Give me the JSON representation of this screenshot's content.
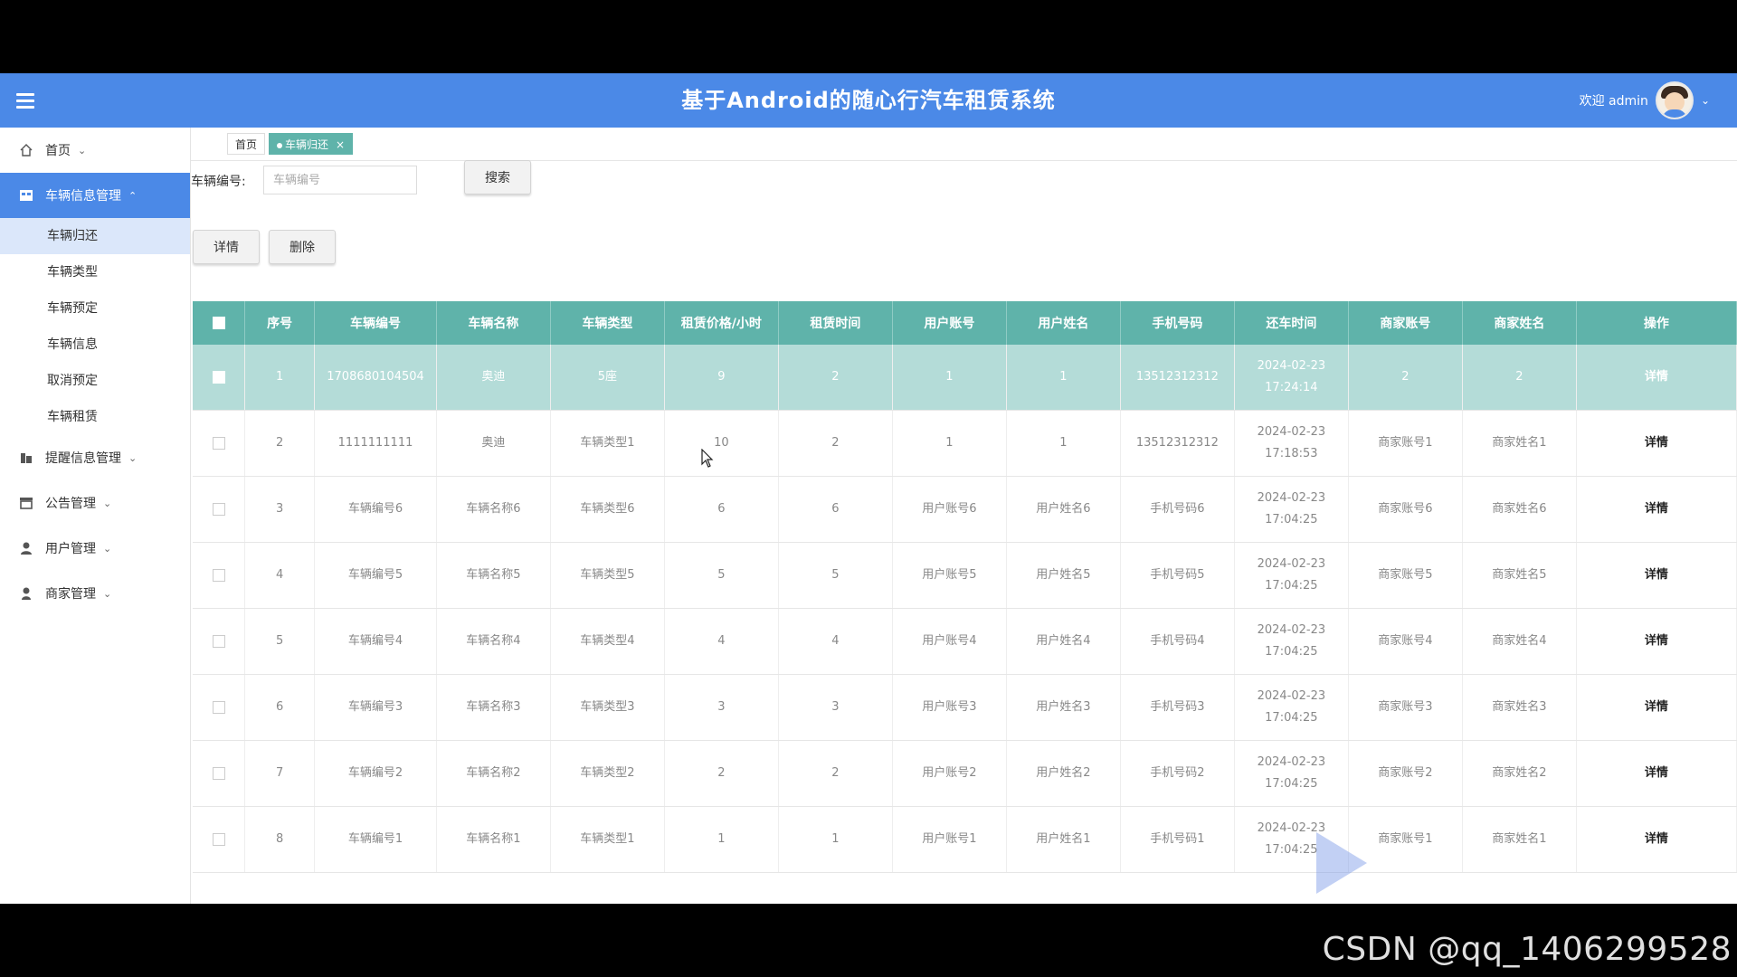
{
  "header": {
    "title": "基于Android的随心行汽车租赁系统",
    "welcome": "欢迎 admin"
  },
  "sidebar": {
    "items": [
      {
        "label": "首页",
        "icon": "home-icon"
      },
      {
        "label": "车辆信息管理",
        "icon": "car-info-icon",
        "active": true
      },
      {
        "label": "提醒信息管理",
        "icon": "reminder-icon"
      },
      {
        "label": "公告管理",
        "icon": "notice-icon"
      },
      {
        "label": "用户管理",
        "icon": "user-icon"
      },
      {
        "label": "商家管理",
        "icon": "merchant-icon"
      }
    ],
    "subitems": [
      "车辆归还",
      "车辆类型",
      "车辆预定",
      "车辆信息",
      "取消预定",
      "车辆租赁"
    ]
  },
  "tabs": {
    "home": "首页",
    "current": "车辆归还",
    "close": "×"
  },
  "search": {
    "label": "车辆编号:",
    "placeholder": "车辆编号",
    "button": "搜索"
  },
  "actions": {
    "detail": "详情",
    "delete": "删除"
  },
  "table": {
    "headers": [
      "序号",
      "车辆编号",
      "车辆名称",
      "车辆类型",
      "租赁价格/小时",
      "租赁时间",
      "用户账号",
      "用户姓名",
      "手机号码",
      "还车时间",
      "商家账号",
      "商家姓名",
      "操作"
    ],
    "rows": [
      [
        "1",
        "1708680104504",
        "奥迪",
        "5座",
        "9",
        "2",
        "1",
        "1",
        "13512312312",
        "2024-02-23 17:24:14",
        "2",
        "2",
        "详情"
      ],
      [
        "2",
        "1111111111",
        "奥迪",
        "车辆类型1",
        "10",
        "2",
        "1",
        "1",
        "13512312312",
        "2024-02-23 17:18:53",
        "商家账号1",
        "商家姓名1",
        "详情"
      ],
      [
        "3",
        "车辆编号6",
        "车辆名称6",
        "车辆类型6",
        "6",
        "6",
        "用户账号6",
        "用户姓名6",
        "手机号码6",
        "2024-02-23 17:04:25",
        "商家账号6",
        "商家姓名6",
        "详情"
      ],
      [
        "4",
        "车辆编号5",
        "车辆名称5",
        "车辆类型5",
        "5",
        "5",
        "用户账号5",
        "用户姓名5",
        "手机号码5",
        "2024-02-23 17:04:25",
        "商家账号5",
        "商家姓名5",
        "详情"
      ],
      [
        "5",
        "车辆编号4",
        "车辆名称4",
        "车辆类型4",
        "4",
        "4",
        "用户账号4",
        "用户姓名4",
        "手机号码4",
        "2024-02-23 17:04:25",
        "商家账号4",
        "商家姓名4",
        "详情"
      ],
      [
        "6",
        "车辆编号3",
        "车辆名称3",
        "车辆类型3",
        "3",
        "3",
        "用户账号3",
        "用户姓名3",
        "手机号码3",
        "2024-02-23 17:04:25",
        "商家账号3",
        "商家姓名3",
        "详情"
      ],
      [
        "7",
        "车辆编号2",
        "车辆名称2",
        "车辆类型2",
        "2",
        "2",
        "用户账号2",
        "用户姓名2",
        "手机号码2",
        "2024-02-23 17:04:25",
        "商家账号2",
        "商家姓名2",
        "详情"
      ],
      [
        "8",
        "车辆编号1",
        "车辆名称1",
        "车辆类型1",
        "1",
        "1",
        "用户账号1",
        "用户姓名1",
        "手机号码1",
        "2024-02-23 17:04:25",
        "商家账号1",
        "商家姓名1",
        "详情"
      ]
    ]
  },
  "watermark": "CSDN @qq_1406299528",
  "colors": {
    "header": "#4b89e7",
    "table_header": "#5fb3aa",
    "selected_row": "#b4dcd8"
  }
}
